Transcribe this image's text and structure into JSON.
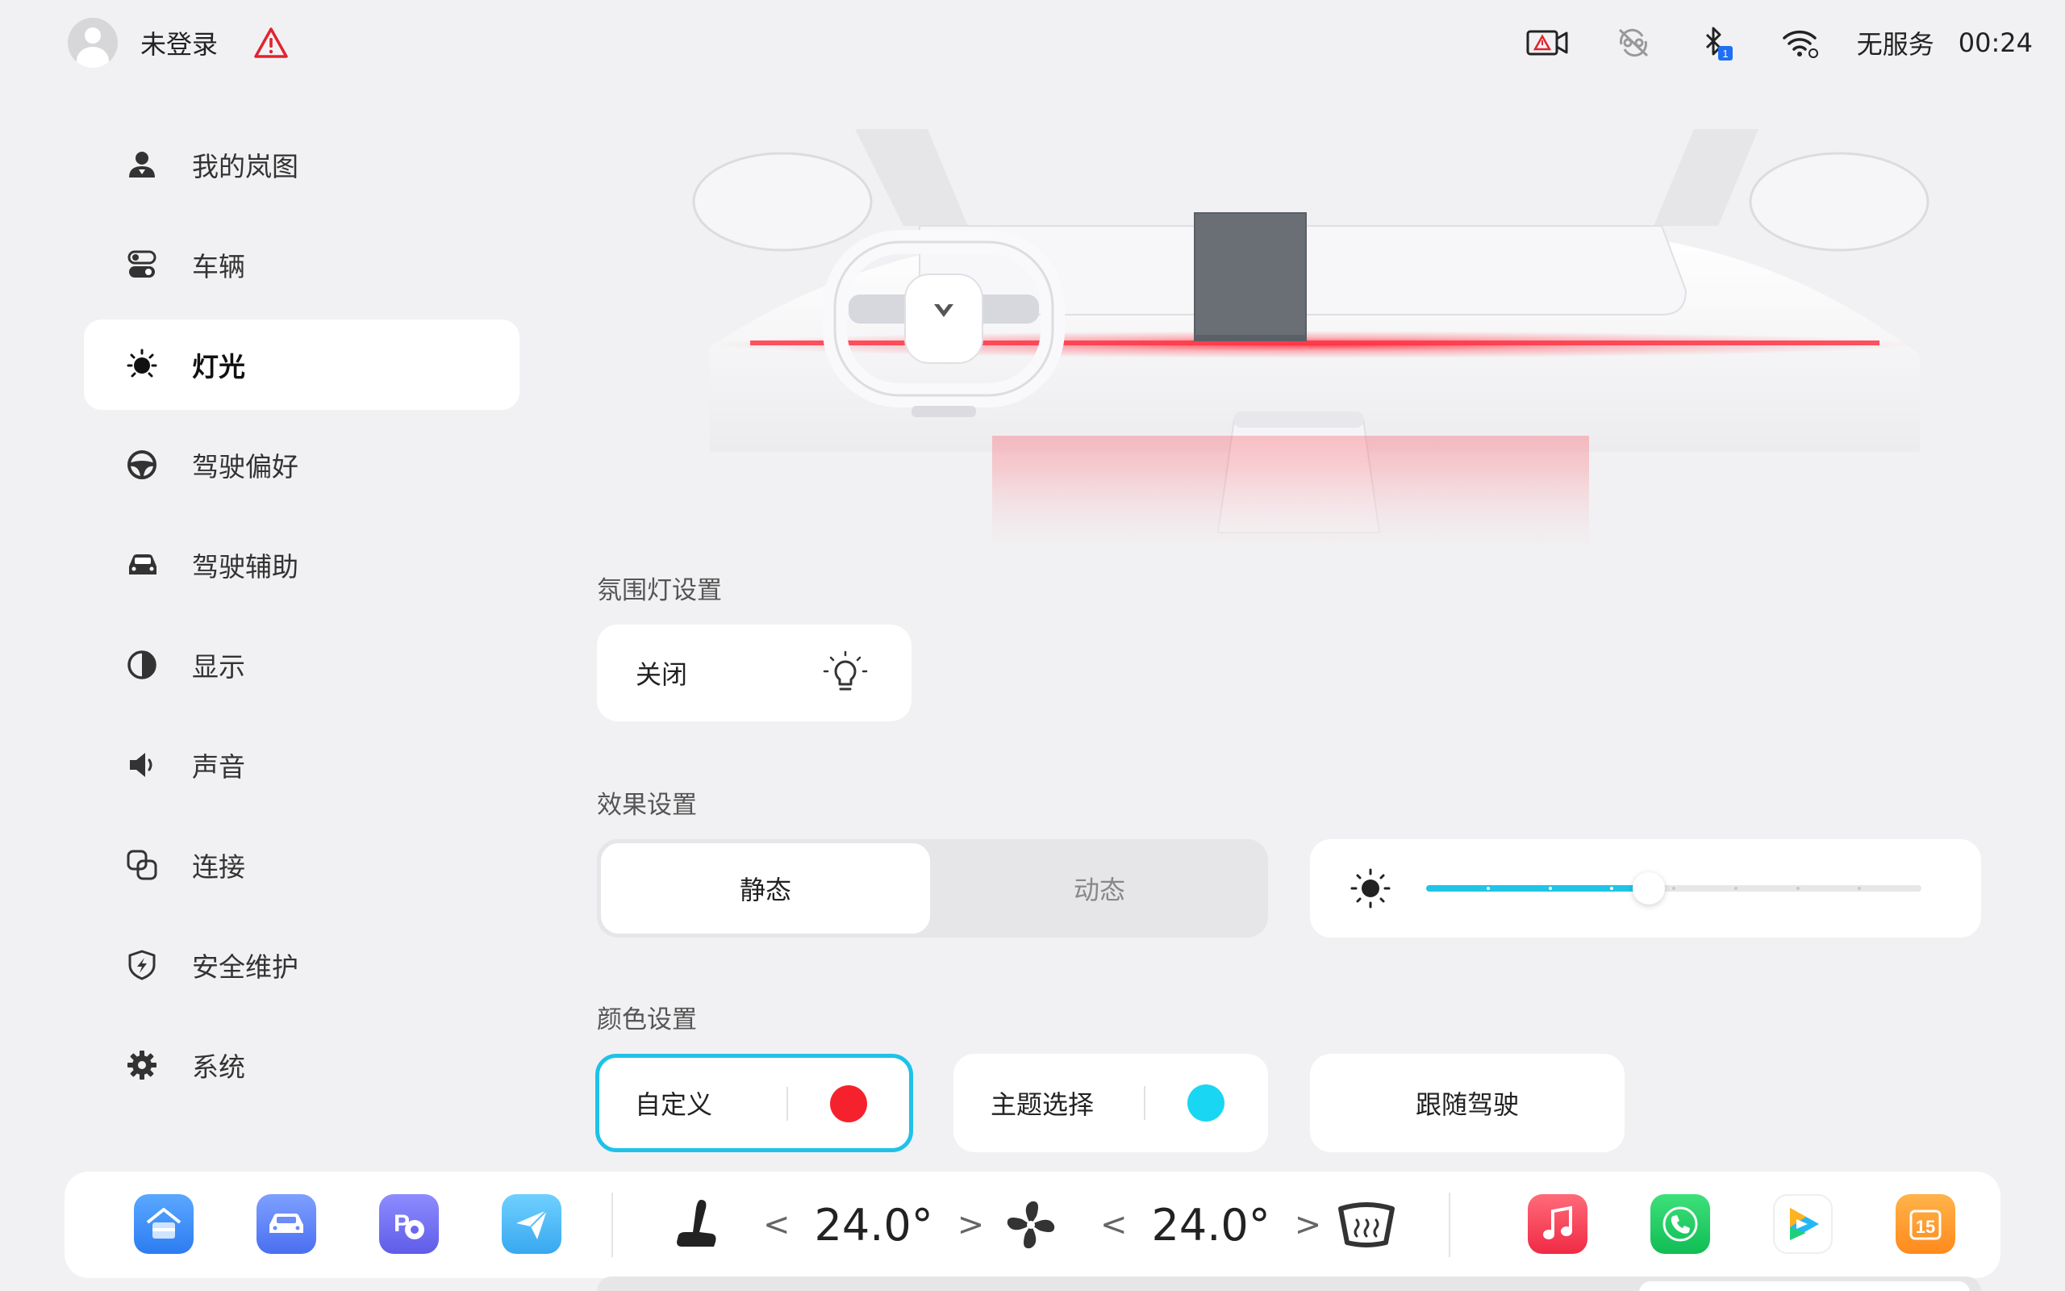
{
  "status_bar": {
    "login_text": "未登录",
    "service_text": "无服务",
    "time": "00:24",
    "bluetooth_badge": "1",
    "icons": [
      "avatar",
      "warning-triangle-icon",
      "camera-warning-icon",
      "connection-off-icon",
      "bluetooth-icon",
      "wifi-icon"
    ]
  },
  "sidebar": {
    "items": [
      {
        "label": "我的岚图",
        "icon": "user-icon"
      },
      {
        "label": "车辆",
        "icon": "vehicle-switch-icon"
      },
      {
        "label": "灯光",
        "icon": "light-icon",
        "active": true
      },
      {
        "label": "驾驶偏好",
        "icon": "steering-wheel-icon"
      },
      {
        "label": "驾驶辅助",
        "icon": "car-assist-icon"
      },
      {
        "label": "显示",
        "icon": "contrast-icon"
      },
      {
        "label": "声音",
        "icon": "speaker-icon"
      },
      {
        "label": "连接",
        "icon": "link-icon"
      },
      {
        "label": "安全维护",
        "icon": "shield-icon"
      },
      {
        "label": "系统",
        "icon": "gear-icon"
      }
    ]
  },
  "main": {
    "ambient": {
      "title": "氛围灯设置",
      "value": "关闭"
    },
    "effect": {
      "title": "效果设置",
      "options": [
        "静态",
        "动态"
      ],
      "selected": "静态",
      "brightness_level": 0.45,
      "brightness_steps": 9
    },
    "color": {
      "title": "颜色设置",
      "options": [
        {
          "label": "自定义",
          "color": "#f5222d",
          "selected": true
        },
        {
          "label": "主题选择",
          "color": "#19d6f2",
          "selected": false
        },
        {
          "label": "跟随驾驶",
          "selected": false
        }
      ]
    }
  },
  "dock": {
    "left_temp": "24.0°",
    "right_temp": "24.0°",
    "left_apps": [
      "home-app-icon",
      "car-app-icon",
      "parking-app-icon",
      "navigation-app-icon"
    ],
    "right_apps": [
      "music-app-icon",
      "phone-app-icon",
      "video-app-icon",
      "calendar-app-icon"
    ],
    "calendar_day": "15"
  },
  "colors": {
    "accent": "#1ec2e8",
    "active_bg": "#ffffff",
    "page_bg": "#f1f1f3",
    "ambient_red": "#ff2a3a"
  }
}
